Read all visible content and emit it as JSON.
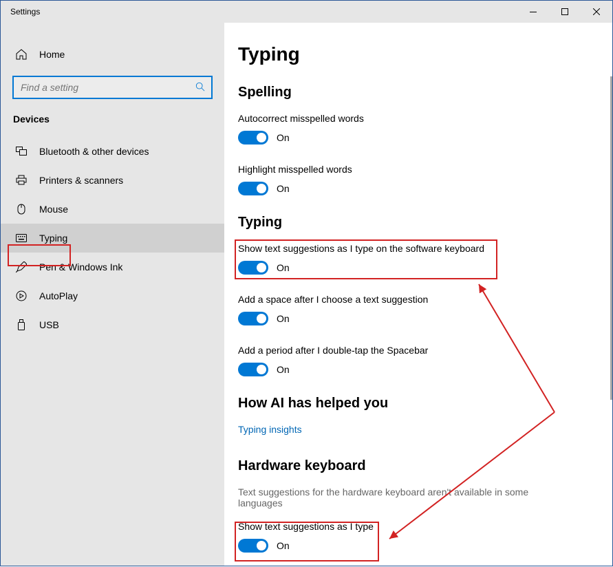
{
  "window": {
    "title": "Settings"
  },
  "sidebar": {
    "home": "Home",
    "search_placeholder": "Find a setting",
    "section": "Devices",
    "items": [
      {
        "label": "Bluetooth & other devices"
      },
      {
        "label": "Printers & scanners"
      },
      {
        "label": "Mouse"
      },
      {
        "label": "Typing"
      },
      {
        "label": "Pen & Windows Ink"
      },
      {
        "label": "AutoPlay"
      },
      {
        "label": "USB"
      }
    ]
  },
  "main": {
    "title": "Typing",
    "sections": {
      "spelling": {
        "heading": "Spelling",
        "autocorrect_label": "Autocorrect misspelled words",
        "autocorrect_state": "On",
        "highlight_label": "Highlight misspelled words",
        "highlight_state": "On"
      },
      "typing": {
        "heading": "Typing",
        "suggest_label": "Show text suggestions as I type on the software keyboard",
        "suggest_state": "On",
        "space_label": "Add a space after I choose a text suggestion",
        "space_state": "On",
        "period_label": "Add a period after I double-tap the Spacebar",
        "period_state": "On"
      },
      "ai": {
        "heading": "How AI has helped you",
        "link": "Typing insights"
      },
      "hardware": {
        "heading": "Hardware keyboard",
        "subtext": "Text suggestions for the hardware keyboard aren't available in some languages",
        "suggest_label": "Show text suggestions as I type",
        "suggest_state": "On"
      }
    }
  }
}
